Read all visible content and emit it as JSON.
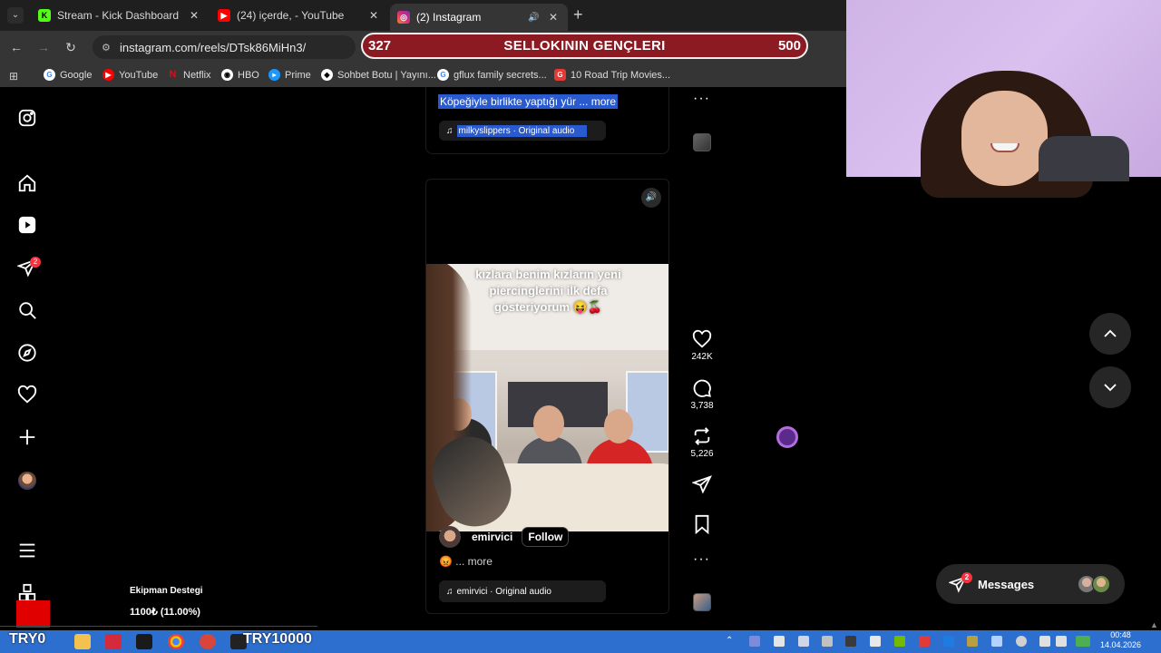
{
  "browser": {
    "tabs": [
      {
        "title": "Stream - Kick Dashboard",
        "favicon": "kick-icon",
        "favicon_color": "#53fc18",
        "active": false
      },
      {
        "title": "(24) içerde, - YouTube",
        "favicon": "youtube-icon",
        "favicon_color": "#ff0000",
        "active": false
      },
      {
        "title": "(2) Instagram",
        "favicon": "instagram-icon",
        "favicon_color": "#e1306c",
        "active": true
      }
    ],
    "url": "instagram.com/reels/DTsk86MiHn3/",
    "bookmarks": [
      {
        "label": "Google",
        "icon": "google-icon"
      },
      {
        "label": "YouTube",
        "icon": "youtube-icon"
      },
      {
        "label": "Netflix",
        "icon": "netflix-icon"
      },
      {
        "label": "HBO",
        "icon": "hbo-icon"
      },
      {
        "label": "Prime",
        "icon": "prime-icon"
      },
      {
        "label": "Sohbet Botu | Yayını...",
        "icon": "bot-icon"
      },
      {
        "label": "gflux family secrets...",
        "icon": "google-icon"
      },
      {
        "label": "10 Road Trip Movies...",
        "icon": "g-icon"
      }
    ]
  },
  "overlay_bar": {
    "left_value": "327",
    "title": "SELLOKININ GENÇLERI",
    "right_value": "500"
  },
  "instagram": {
    "nav_icons": [
      "instagram-logo-icon",
      "home-icon",
      "reels-icon",
      "direct-icon",
      "search-icon",
      "explore-icon",
      "heart-icon",
      "create-icon",
      "profile-icon",
      "menu-icon",
      "more-icon"
    ],
    "direct_badge": "2",
    "prev_reel": {
      "caption": "Köpeğiyle birlikte yaptığı yür",
      "more": "... more",
      "audio": "milkyslippers · Original audio"
    },
    "reel": {
      "video_caption_l1": "kızlara benim kızların yeni",
      "video_caption_l2": "piercinglerini ilk defa",
      "video_caption_l3": "gösteriyorum 😝🍒",
      "username": "emirvici",
      "follow_label": "Follow",
      "more_text": "😡 ... more",
      "audio": "emirvici · Original audio",
      "likes": "242K",
      "comments": "3,738",
      "reposts": "5,226"
    },
    "messages": {
      "label": "Messages",
      "badge": "2"
    }
  },
  "stream_overlay": {
    "donation_title": "Ekipman Destegi",
    "donation_amount": "1100₺ (11.00%)",
    "donation_progress_pct": 11,
    "taskbar_left_text": "TRY0",
    "taskbar_mid_text": "TRY10000"
  },
  "clock": {
    "time": "00:48",
    "date": "14.04.2026"
  },
  "colors": {
    "accent_blue": "#2a5ad0",
    "notification": "#ff3040",
    "overlay_red": "#8b1a22",
    "taskbar": "#2d6fcf"
  }
}
